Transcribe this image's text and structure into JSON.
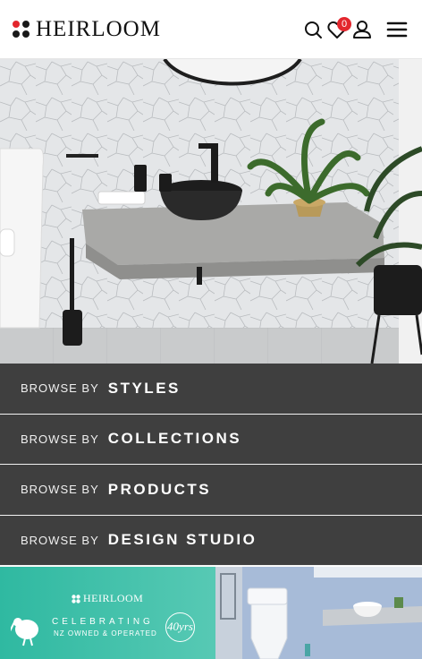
{
  "header": {
    "brand": "HEIRLOOM",
    "wishlist_count": "0",
    "icons": [
      "search-icon",
      "heart-icon",
      "user-icon",
      "menu-icon"
    ]
  },
  "hero": {
    "slides_total": 4,
    "active_slide": 1
  },
  "browse": {
    "items": [
      {
        "pre": "BROWSE BY",
        "label": "STYLES"
      },
      {
        "pre": "BROWSE BY",
        "label": "COLLECTIONS"
      },
      {
        "pre": "BROWSE BY",
        "label": "PRODUCTS"
      },
      {
        "pre": "BROWSE BY",
        "label": "DESIGN STUDIO"
      }
    ]
  },
  "banners": {
    "left": {
      "brand": "HEIRLOOM",
      "line1": "CELEBRATING",
      "line2": "NZ OWNED & OPERATED",
      "badge": "40yrs"
    }
  },
  "colors": {
    "accent": "#e3262d",
    "row_bg": "#3f3f3f",
    "banner_green": "#3bbfa8"
  }
}
